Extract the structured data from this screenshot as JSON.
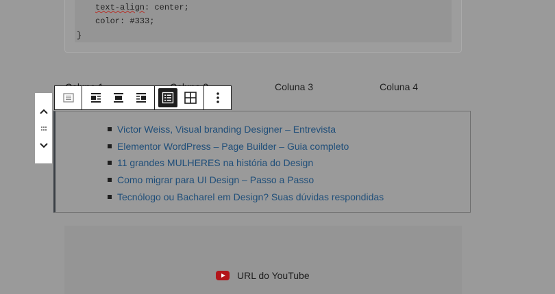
{
  "code": {
    "line1_prop": "text-align",
    "line1_rest": ": center;",
    "line2": "color: #333;",
    "line3": "}"
  },
  "columns": {
    "col1": "Coluna 1",
    "col2": "Coluna 2",
    "col3": "Coluna 3",
    "col4": "Coluna 4"
  },
  "toolbar": {
    "icons": [
      "list-view-icon",
      "align-left-icon",
      "align-center-icon",
      "align-right-icon",
      "list-icon",
      "grid-icon",
      "more-options-icon"
    ],
    "active_icon": "list-icon"
  },
  "posts": [
    "Victor Weiss, Visual branding Designer – Entrevista",
    "Elementor WordPress – Page Builder – Guia completo",
    "11 grandes MULHERES na história do Design",
    "Como migrar para UI Design – Passo a Passo",
    "Tecnólogo ou Bacharel em Design? Suas dúvidas respondidas"
  ],
  "embed": {
    "label": "URL do YouTube"
  },
  "colors": {
    "link": "#1f4e79",
    "youtube_red": "#b3151a",
    "overlay": "#9a9a9a"
  }
}
